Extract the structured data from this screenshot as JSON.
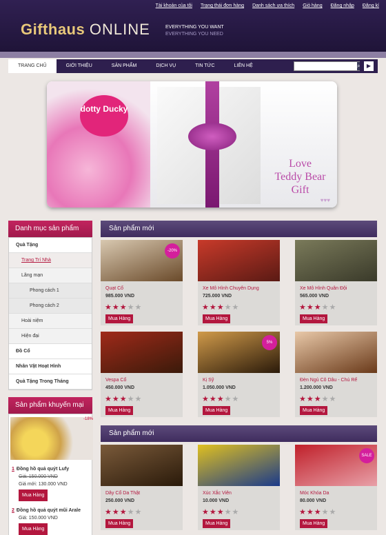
{
  "top_links": [
    "Tài khoản của tôi",
    "Trạng thái đơn hàng",
    "Danh sách ưa thích",
    "Giỏ hàng",
    "Đăng nhập",
    "Đăng kí"
  ],
  "logo": {
    "brand": "Gifthaus",
    "suffix": "ONLINE"
  },
  "slogan": [
    "EVERYTHING YOU WANT",
    "EVERYTHING YOU NEED"
  ],
  "nav": [
    "TRANG CHỦ",
    "GIỚI THIỆU",
    "SẢN PHẨM",
    "DỊCH VỤ",
    "TIN TỨC",
    "LIÊN HỆ"
  ],
  "search": {
    "placeholder": ""
  },
  "banner": {
    "ducky": "dotty Ducky",
    "love": [
      "Love",
      "Teddy Bear",
      "Gift"
    ],
    "hearts": "♥♥♥"
  },
  "sidebar": {
    "title": "Danh mục sản phẩm",
    "items": [
      {
        "label": "Quà Tặng",
        "level": 0
      },
      {
        "label": "Trang Trí Nhà",
        "level": 1,
        "active": true
      },
      {
        "label": "Lãng mạn",
        "level": 1
      },
      {
        "label": "Phong cách 1",
        "level": 2
      },
      {
        "label": "Phong cách 2",
        "level": 2
      },
      {
        "label": "Hoài niệm",
        "level": 1
      },
      {
        "label": "Hiện đại",
        "level": 1
      },
      {
        "label": "Đồ Cổ",
        "level": 0
      },
      {
        "label": "Nhân Vật Hoạt Hình",
        "level": 0
      },
      {
        "label": "Quà Tặng Trong Tháng",
        "level": 0
      }
    ]
  },
  "promo": {
    "title": "Sản phẩm khuyến mại",
    "tag": "-18%",
    "items": [
      {
        "num": "1",
        "name": "Đồng hồ quả quýt Lufy",
        "old": "Giá: 150.000 VND",
        "new": "Giá mới: 130.000 VND",
        "button": "Mua Hàng"
      },
      {
        "num": "2",
        "name": "Đồng hồ quả quýt mũi Arale",
        "old": "",
        "new": "Giá: 150.000 VND",
        "button": "Mua Hàng"
      }
    ]
  },
  "sections": [
    {
      "title": "Sản phẩm mới",
      "products": [
        {
          "name": "Quạt Cổ",
          "price": "985.000 VND",
          "rating": 3,
          "badge": "-20%",
          "button": "Mua Hàng",
          "colors": [
            "#6a4a2a",
            "#d8c8b0"
          ]
        },
        {
          "name": "Xe Mô Hình Chuyên Dụng",
          "price": "725.000 VND",
          "rating": 3,
          "badge": "",
          "button": "Mua Hàng",
          "colors": [
            "#5a1a14",
            "#c83a2a"
          ]
        },
        {
          "name": "Xe Mô Hình Quân Đội",
          "price": "565.000 VND",
          "rating": 3,
          "badge": "",
          "button": "Mua Hàng",
          "colors": [
            "#3a3a2a",
            "#7a7a5a"
          ]
        },
        {
          "name": "Vespa Cổ",
          "price": "450.000 VND",
          "rating": 3,
          "badge": "",
          "button": "Mua Hàng",
          "colors": [
            "#3a1a0a",
            "#a02a1a"
          ]
        },
        {
          "name": "Kị Sỹ",
          "price": "1.050.000 VND",
          "rating": 3,
          "badge": "5%",
          "button": "Mua Hàng",
          "colors": [
            "#2a1a0a",
            "#d09a4a"
          ]
        },
        {
          "name": "Đèn Ngủ Cô Dâu - Chú Rể",
          "price": "1.200.000 VND",
          "rating": 3,
          "badge": "",
          "button": "Mua Hàng",
          "colors": [
            "#6a3a1a",
            "#e8c8a8"
          ]
        }
      ]
    },
    {
      "title": "Sản phẩm mới",
      "products": [
        {
          "name": "Dây Cổ Da Thật",
          "price": "250.000 VND",
          "rating": 3,
          "badge": "",
          "button": "Mua Hàng",
          "colors": [
            "#2a1a0a",
            "#7a5a3a"
          ]
        },
        {
          "name": "Xúc Xắc Viên",
          "price": "10.000 VND",
          "rating": 3,
          "badge": "",
          "button": "Mua Hàng",
          "colors": [
            "#1a3a8a",
            "#e0c020"
          ]
        },
        {
          "name": "Móc Khóa Da",
          "price": "80.000 VND",
          "rating": 3,
          "badge": "SALE",
          "button": "Mua Hàng",
          "colors": [
            "#e8a0a8",
            "#c0202a"
          ]
        }
      ]
    }
  ]
}
